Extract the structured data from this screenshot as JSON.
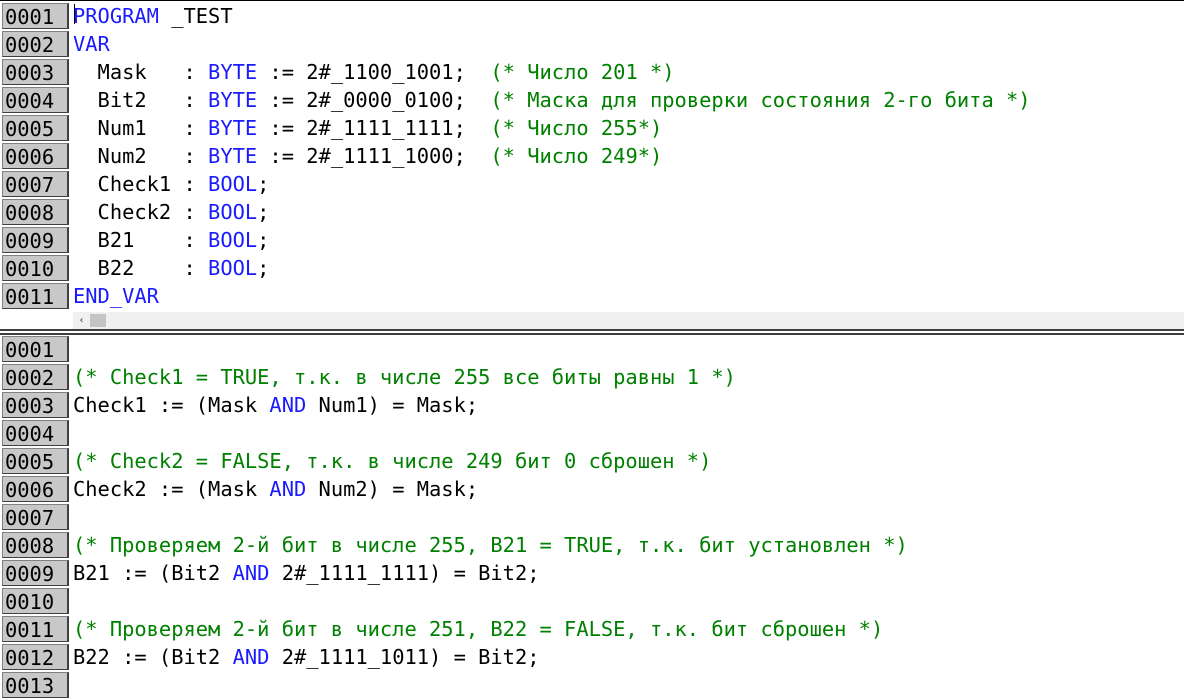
{
  "declaration_editor": {
    "lines": [
      {
        "num": "0001",
        "tokens": [
          {
            "t": "PROGRAM",
            "c": "kw"
          },
          {
            "t": " _TEST",
            "c": ""
          }
        ]
      },
      {
        "num": "0002",
        "tokens": [
          {
            "t": "VAR",
            "c": "kw"
          }
        ]
      },
      {
        "num": "0003",
        "tokens": [
          {
            "t": "  Mask   : ",
            "c": ""
          },
          {
            "t": "BYTE",
            "c": "kw"
          },
          {
            "t": " := 2#_1100_1001;  ",
            "c": ""
          },
          {
            "t": "(* Число 201 *)",
            "c": "cm"
          }
        ]
      },
      {
        "num": "0004",
        "tokens": [
          {
            "t": "  Bit2   : ",
            "c": ""
          },
          {
            "t": "BYTE",
            "c": "kw"
          },
          {
            "t": " := 2#_0000_0100;  ",
            "c": ""
          },
          {
            "t": "(* Маска для проверки состояния 2-го бита *)",
            "c": "cm"
          }
        ]
      },
      {
        "num": "0005",
        "tokens": [
          {
            "t": "  Num1   : ",
            "c": ""
          },
          {
            "t": "BYTE",
            "c": "kw"
          },
          {
            "t": " := 2#_1111_1111;  ",
            "c": ""
          },
          {
            "t": "(* Число 255*)",
            "c": "cm"
          }
        ]
      },
      {
        "num": "0006",
        "tokens": [
          {
            "t": "  Num2   : ",
            "c": ""
          },
          {
            "t": "BYTE",
            "c": "kw"
          },
          {
            "t": " := 2#_1111_1000;  ",
            "c": ""
          },
          {
            "t": "(* Число 249*)",
            "c": "cm"
          }
        ]
      },
      {
        "num": "0007",
        "tokens": [
          {
            "t": "  Check1 : ",
            "c": ""
          },
          {
            "t": "BOOL",
            "c": "kw"
          },
          {
            "t": ";",
            "c": ""
          }
        ]
      },
      {
        "num": "0008",
        "tokens": [
          {
            "t": "  Check2 : ",
            "c": ""
          },
          {
            "t": "BOOL",
            "c": "kw"
          },
          {
            "t": ";",
            "c": ""
          }
        ]
      },
      {
        "num": "0009",
        "tokens": [
          {
            "t": "  B21    : ",
            "c": ""
          },
          {
            "t": "BOOL",
            "c": "kw"
          },
          {
            "t": ";",
            "c": ""
          }
        ]
      },
      {
        "num": "0010",
        "tokens": [
          {
            "t": "  B22    : ",
            "c": ""
          },
          {
            "t": "BOOL",
            "c": "kw"
          },
          {
            "t": ";",
            "c": ""
          }
        ]
      },
      {
        "num": "0011",
        "tokens": [
          {
            "t": "END_VAR",
            "c": "kw"
          }
        ]
      }
    ]
  },
  "scrollbar": {
    "left_arrow": "‹"
  },
  "body_editor": {
    "lines": [
      {
        "num": "0001",
        "tokens": []
      },
      {
        "num": "0002",
        "tokens": [
          {
            "t": "(* Check1 = TRUE, т.к. в числе 255 все биты равны 1 *)",
            "c": "cm"
          }
        ]
      },
      {
        "num": "0003",
        "tokens": [
          {
            "t": "Check1 := (Mask ",
            "c": ""
          },
          {
            "t": "AND",
            "c": "kw"
          },
          {
            "t": " Num1) = Mask;",
            "c": ""
          }
        ]
      },
      {
        "num": "0004",
        "tokens": []
      },
      {
        "num": "0005",
        "tokens": [
          {
            "t": "(* Check2 = FALSE, т.к. в числе 249 бит 0 сброшен *)",
            "c": "cm"
          }
        ]
      },
      {
        "num": "0006",
        "tokens": [
          {
            "t": "Check2 := (Mask ",
            "c": ""
          },
          {
            "t": "AND",
            "c": "kw"
          },
          {
            "t": " Num2) = Mask;",
            "c": ""
          }
        ]
      },
      {
        "num": "0007",
        "tokens": []
      },
      {
        "num": "0008",
        "tokens": [
          {
            "t": "(* Проверяем 2-й бит в числе 255, B21 = TRUE, т.к. бит установлен *)",
            "c": "cm"
          }
        ]
      },
      {
        "num": "0009",
        "tokens": [
          {
            "t": "B21 := (Bit2 ",
            "c": ""
          },
          {
            "t": "AND",
            "c": "kw"
          },
          {
            "t": " 2#_1111_1111) = Bit2;",
            "c": ""
          }
        ]
      },
      {
        "num": "0010",
        "tokens": []
      },
      {
        "num": "0011",
        "tokens": [
          {
            "t": "(* Проверяем 2-й бит в числе 251, B22 = FALSE, т.к. бит сброшен *)",
            "c": "cm"
          }
        ]
      },
      {
        "num": "0012",
        "tokens": [
          {
            "t": "B22 := (Bit2 ",
            "c": ""
          },
          {
            "t": "AND",
            "c": "kw"
          },
          {
            "t": " 2#_1111_1011) = Bit2;",
            "c": ""
          }
        ]
      },
      {
        "num": "0013",
        "tokens": []
      }
    ]
  },
  "colors": {
    "keyword": "#1a1aff",
    "comment": "#008000",
    "gutter_bg": "#c8c8c8",
    "text": "#000000"
  }
}
